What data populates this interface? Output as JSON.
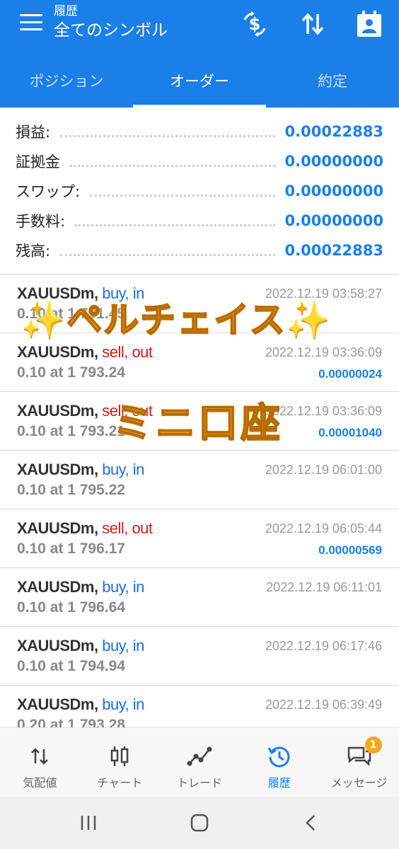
{
  "header": {
    "subtitle": "履歴",
    "title": "全てのシンボル",
    "buttons": [
      "currency-switch-icon",
      "sort-icon",
      "calendar-icon"
    ]
  },
  "tabs": [
    {
      "label": "ポジション",
      "active": false
    },
    {
      "label": "オーダー",
      "active": true
    },
    {
      "label": "約定",
      "active": false
    }
  ],
  "summary": [
    {
      "label": "損益:",
      "value": "0.00022883"
    },
    {
      "label": "証拠金",
      "value": "0.00000000"
    },
    {
      "label": "スワップ:",
      "value": "0.00000000"
    },
    {
      "label": "手数料:",
      "value": "0.00000000"
    },
    {
      "label": "残高:",
      "value": "0.00022883"
    }
  ],
  "trades": [
    {
      "symbol": "XAUUSDm,",
      "side": "buy, in",
      "volume": "0.10 at 1 791.45",
      "time": "2022.12.19 03:58:27",
      "profit": ""
    },
    {
      "symbol": "XAUUSDm,",
      "side": "sell, out",
      "volume": "0.10 at 1 793.24",
      "time": "2022.12.19 03:36:09",
      "profit": "0.00000024"
    },
    {
      "symbol": "XAUUSDm,",
      "side": "sell, out",
      "volume": "0.10 at 1 793.21",
      "time": "2022.12.19 03:36:09",
      "profit": "0.00001040"
    },
    {
      "symbol": "XAUUSDm,",
      "side": "buy, in",
      "volume": "0.10 at 1 795.22",
      "time": "2022.12.19 06:01:00",
      "profit": ""
    },
    {
      "symbol": "XAUUSDm,",
      "side": "sell, out",
      "volume": "0.10 at 1 796.17",
      "time": "2022.12.19 06:05:44",
      "profit": "0.00000569"
    },
    {
      "symbol": "XAUUSDm,",
      "side": "buy, in",
      "volume": "0.10 at 1 796.64",
      "time": "2022.12.19 06:11:01",
      "profit": ""
    },
    {
      "symbol": "XAUUSDm,",
      "side": "buy, in",
      "volume": "0.10 at 1 794.94",
      "time": "2022.12.19 06:17:46",
      "profit": ""
    },
    {
      "symbol": "XAUUSDm,",
      "side": "buy, in",
      "volume": "0.20 at 1 793.28",
      "time": "2022.12.19 06:39:49",
      "profit": ""
    }
  ],
  "overlay": {
    "line1": "ペルチェイス",
    "line2": "ミニ口座",
    "sparkle": "✨"
  },
  "bottom_nav": [
    {
      "label": "気配値",
      "icon": "quotes-icon",
      "active": false
    },
    {
      "label": "チャート",
      "icon": "chart-icon",
      "active": false
    },
    {
      "label": "トレード",
      "icon": "trade-icon",
      "active": false
    },
    {
      "label": "履歴",
      "icon": "history-icon",
      "active": true
    },
    {
      "label": "メッセージ",
      "icon": "messages-icon",
      "active": false,
      "badge": "1"
    }
  ],
  "colors": {
    "primary": "#1a7fe8",
    "buy": "#1a6fe0",
    "sell": "#d01a1a",
    "badge": "#f5a623"
  }
}
